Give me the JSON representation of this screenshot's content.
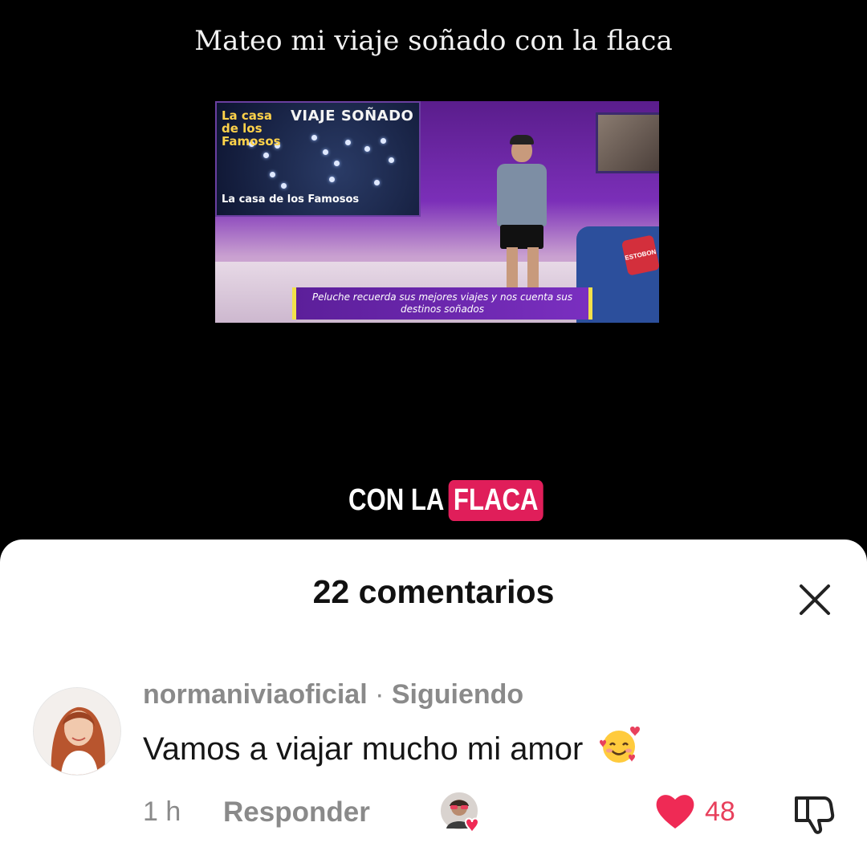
{
  "video": {
    "caption": "Mateo mi viaje soñado con la flaca",
    "clip": {
      "map_title": "VIAJE SOÑADO",
      "show_logo": "La casa de los Famosos",
      "show_logo_bottom": "La casa de los Famosos",
      "pillow_text": "ESTOBON",
      "lower_third": "Peluche recuerda sus mejores viajes y nos cuenta sus destinos soñados"
    },
    "overlay": {
      "text_plain": "CON LA",
      "text_highlight": "FLACA",
      "highlight_color": "#e01e5a"
    }
  },
  "comments_sheet": {
    "title": "22 comentarios",
    "close_icon": "close-icon",
    "comments": [
      {
        "username": "normaniviaoficial",
        "separator": " · ",
        "status": "Siguiendo",
        "text": "Vamos a viajar mucho mi amor",
        "emoji": "smiling-face-with-hearts",
        "time": "1 h",
        "reply_label": "Responder",
        "likes": "48",
        "like_color": "#e8405c"
      }
    ]
  }
}
